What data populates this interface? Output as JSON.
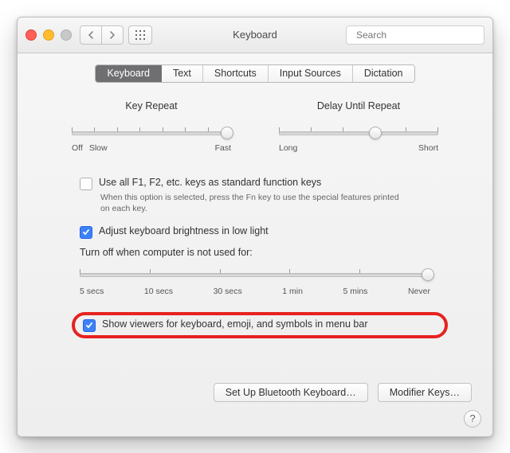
{
  "window": {
    "title": "Keyboard"
  },
  "search": {
    "placeholder": "Search"
  },
  "tabs": [
    "Keyboard",
    "Text",
    "Shortcuts",
    "Input Sources",
    "Dictation"
  ],
  "sliders": {
    "keyRepeat": {
      "label": "Key Repeat",
      "left": "Off",
      "left2": "Slow",
      "right": "Fast",
      "ticks": 8,
      "pos": 0.97
    },
    "delayRepeat": {
      "label": "Delay Until Repeat",
      "left": "Long",
      "right": "Short",
      "ticks": 6,
      "pos": 0.6
    }
  },
  "options": {
    "fnKeys": {
      "checked": false,
      "label": "Use all F1, F2, etc. keys as standard function keys",
      "sub": "When this option is selected, press the Fn key to use the special features printed on each key."
    },
    "bright": {
      "checked": true,
      "label": "Adjust keyboard brightness in low light"
    },
    "turnOff": {
      "label": "Turn off when computer is not used for:",
      "labels": [
        "5 secs",
        "10 secs",
        "30 secs",
        "1 min",
        "5 mins",
        "Never"
      ],
      "pos": 0.99
    },
    "viewers": {
      "checked": true,
      "label": "Show viewers for keyboard, emoji, and symbols in menu bar"
    }
  },
  "buttons": {
    "bluetooth": "Set Up Bluetooth Keyboard…",
    "modifier": "Modifier Keys…"
  }
}
